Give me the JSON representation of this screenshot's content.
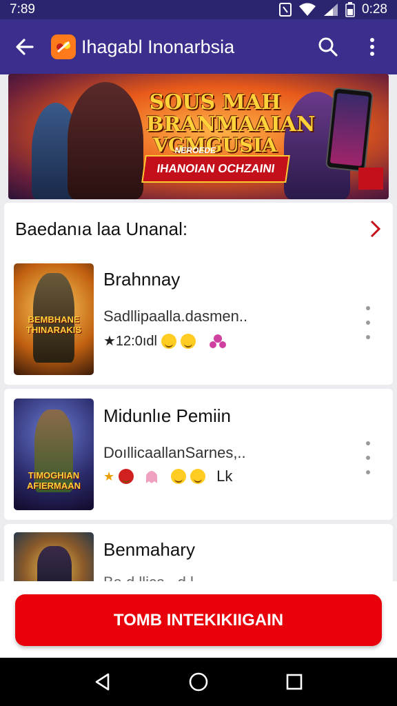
{
  "status_bar": {
    "time": "7:89",
    "clock_right": "0:28"
  },
  "app_bar": {
    "title": "Ihagabl Inonarbsia"
  },
  "banner": {
    "line1": "SOUS MAH",
    "line2": "BRANMAAIAN",
    "line3": "VGMGUSIA",
    "ribbon_small": "NEROEDE",
    "ribbon": "IHANOIAN OCHZAINI"
  },
  "section": {
    "title": "Baedanıa laa Unanal:"
  },
  "games": [
    {
      "name": "Brahnnay",
      "subtitle": "Sadllipaalla.dasmen..",
      "meta": "★12:0ıdl",
      "thumb_text": "BEMBHANE THINARAKIS"
    },
    {
      "name": "Midunlıe Pemiin",
      "subtitle": "DoıllicaallanSarnes,..",
      "meta": "Lk",
      "thumb_text": "TIMOGHIAN AFIERMAAN"
    },
    {
      "name": "Benmahary",
      "subtitle": "Ba.d.llica...d.l..",
      "meta": ""
    }
  ],
  "cta": {
    "label": "TOMB INTEKIKIIGAIN"
  },
  "colors": {
    "status_bar": "#2b2570",
    "app_bar": "#3a2f8c",
    "cta": "#e8000a",
    "accent_chevron": "#c4101a"
  }
}
